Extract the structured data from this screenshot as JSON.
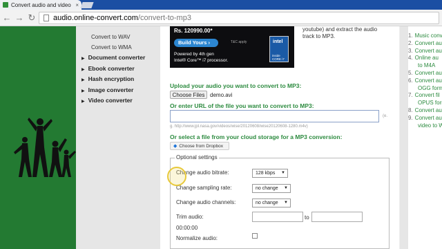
{
  "browser": {
    "tab_title": "Convert audio and video t",
    "tab_close": "×",
    "url_host": "audio.online-convert.com",
    "url_path": "/convert-to-mp3"
  },
  "leftnav": {
    "subitems": [
      "Convert to WAV",
      "Convert to WMA"
    ],
    "categories": [
      "Document converter",
      "Ebook converter",
      "Hash encryption",
      "Image converter",
      "Video converter"
    ]
  },
  "ad": {
    "price": "Rs. 120990.00*",
    "build_label": "Build Yours",
    "tc": "T&C apply",
    "powered_line1": "Powered by 4th gen",
    "powered_line2": "Intel® Core™ i7 processor.",
    "intel_brand": "intel",
    "intel_badge_line1": "inside",
    "intel_badge_line2": "CORE i7"
  },
  "ad_side_text": {
    "line1": "youtube) and extract the audio",
    "line2": "track to MP3."
  },
  "upload": {
    "heading": "Upload your audio you want to convert to MP3:",
    "choose_label": "Choose Files",
    "filename": "demo.avi"
  },
  "url_section": {
    "heading": "Or enter URL of the file you want to convert to MP3:",
    "side_hint": "(e.",
    "example": "g. http://www.jpl.nasa.gov/videos/wise/20120608/wise20120608-1280.m4v)"
  },
  "cloud": {
    "heading": "Or select a file from your cloud storage for a MP3 conversion:",
    "dropbox_label": "Choose from Dropbox"
  },
  "optional": {
    "legend": "Optional settings",
    "bitrate_label": "Change audio bitrate:",
    "bitrate_value": "128 kbps",
    "sampling_label": "Change sampling rate:",
    "sampling_value": "no change",
    "channels_label": "Change audio channels:",
    "channels_value": "no change",
    "trim_label": "Trim audio:",
    "trim_to": "to",
    "trim_time": "00:00:00",
    "normalize_label": "Normalize audio:"
  },
  "rightlist": {
    "items": [
      {
        "num": "1.",
        "text": "Music conv"
      },
      {
        "num": "2.",
        "text": "Convert au"
      },
      {
        "num": "3.",
        "text": "Convert au"
      },
      {
        "num": "4.",
        "text": "Online au"
      },
      {
        "num": "",
        "text": "to M4A"
      },
      {
        "num": "5.",
        "text": "Convert au"
      },
      {
        "num": "6.",
        "text": "Convert au"
      },
      {
        "num": "",
        "text": "OGG forma"
      },
      {
        "num": "7.",
        "text": "Convert fil"
      },
      {
        "num": "",
        "text": "OPUS form"
      },
      {
        "num": "8.",
        "text": "Convert au"
      },
      {
        "num": "9.",
        "text": "Convert au"
      },
      {
        "num": "",
        "text": "video to W"
      }
    ]
  },
  "colors": {
    "brand_green": "#237a32",
    "heading_green": "#2b8a3e",
    "sidebar_gray": "#e6e6e6",
    "tabstrip_blue": "#1b4fa3"
  }
}
